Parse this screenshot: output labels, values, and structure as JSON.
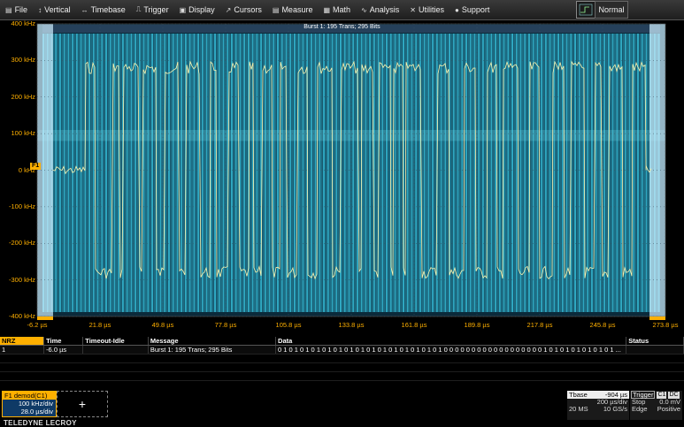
{
  "menu": [
    {
      "label": "File",
      "icon": "file-icon",
      "glyph": "▤"
    },
    {
      "label": "Vertical",
      "icon": "vertical-icon",
      "glyph": "↕"
    },
    {
      "label": "Timebase",
      "icon": "timebase-icon",
      "glyph": "↔"
    },
    {
      "label": "Trigger",
      "icon": "trigger-icon",
      "glyph": "⎍"
    },
    {
      "label": "Display",
      "icon": "display-icon",
      "glyph": "▣"
    },
    {
      "label": "Cursors",
      "icon": "cursors-icon",
      "glyph": "↗"
    },
    {
      "label": "Measure",
      "icon": "measure-icon",
      "glyph": "▤"
    },
    {
      "label": "Math",
      "icon": "math-icon",
      "glyph": "▦"
    },
    {
      "label": "Analysis",
      "icon": "analysis-icon",
      "glyph": "∿"
    },
    {
      "label": "Utilities",
      "icon": "utilities-icon",
      "glyph": "✕"
    },
    {
      "label": "Support",
      "icon": "support-icon",
      "glyph": "●"
    }
  ],
  "trigger_mode": "Normal",
  "burst_label": "Burst 1: 195 Trans; 295 Bits",
  "trace_marker": "F1",
  "chart_data": {
    "type": "line",
    "ylabels": [
      "400 kHz",
      "300 kHz",
      "200 kHz",
      "100 kHz",
      "0 kHz",
      "-100 kHz",
      "-200 kHz",
      "-300 kHz",
      "-400 kHz"
    ],
    "xlabels": [
      "-6.2 µs",
      "21.8 µs",
      "49.8 µs",
      "77.8 µs",
      "105.8 µs",
      "133.8 µs",
      "161.8 µs",
      "189.8 µs",
      "217.8 µs",
      "245.8 µs",
      "273.8 µs"
    ],
    "ylim": [
      -400,
      400
    ],
    "xlim": [
      -6.2,
      273.8
    ],
    "high_level_khz": 280,
    "low_level_khz": -280,
    "bit_count": 295,
    "colors": {
      "trace": "#fff6b0",
      "bits": "#2fa8c2",
      "bitsDark": "#1e6f86",
      "label": "#ffb000"
    }
  },
  "table": {
    "headers": [
      "NRZ",
      "Time",
      "Timeout-Idle",
      "Message",
      "Data",
      "Status"
    ],
    "rows": [
      {
        "idx": "1",
        "time": "-6.0 µs",
        "timeout": "",
        "message": "Burst 1: 195 Trans; 295 Bits",
        "data": "0 1 0 1 0 1 0 1 0 1 0 1 0 1 0 1 0 1 0 1 0 1 0 1 0 1 0 1 0 1 0 0 0 0 0 0 0 0 0 0 0 0 0 0 0 0 0 0 1 0 1 0 1 0 1 0 1 0 1 0 1 ...",
        "status": ""
      }
    ]
  },
  "f1": {
    "title": "F1   demod(C1)",
    "vdiv": "100 kHz/div",
    "tdiv": "28.0 µs/div"
  },
  "add_label": "+",
  "brand": "TELEDYNE LECROY",
  "timebase": {
    "title": "Tbase",
    "delay": "-904 µs",
    "tdiv": "200 µs/div",
    "samples": "20 MS",
    "rate": "10 GS/s"
  },
  "trigger": {
    "title": "Trigger",
    "ch": "C1",
    "coupling": "DC",
    "mode": "Stop",
    "level": "0.0 mV",
    "type": "Edge",
    "slope": "Positive"
  }
}
